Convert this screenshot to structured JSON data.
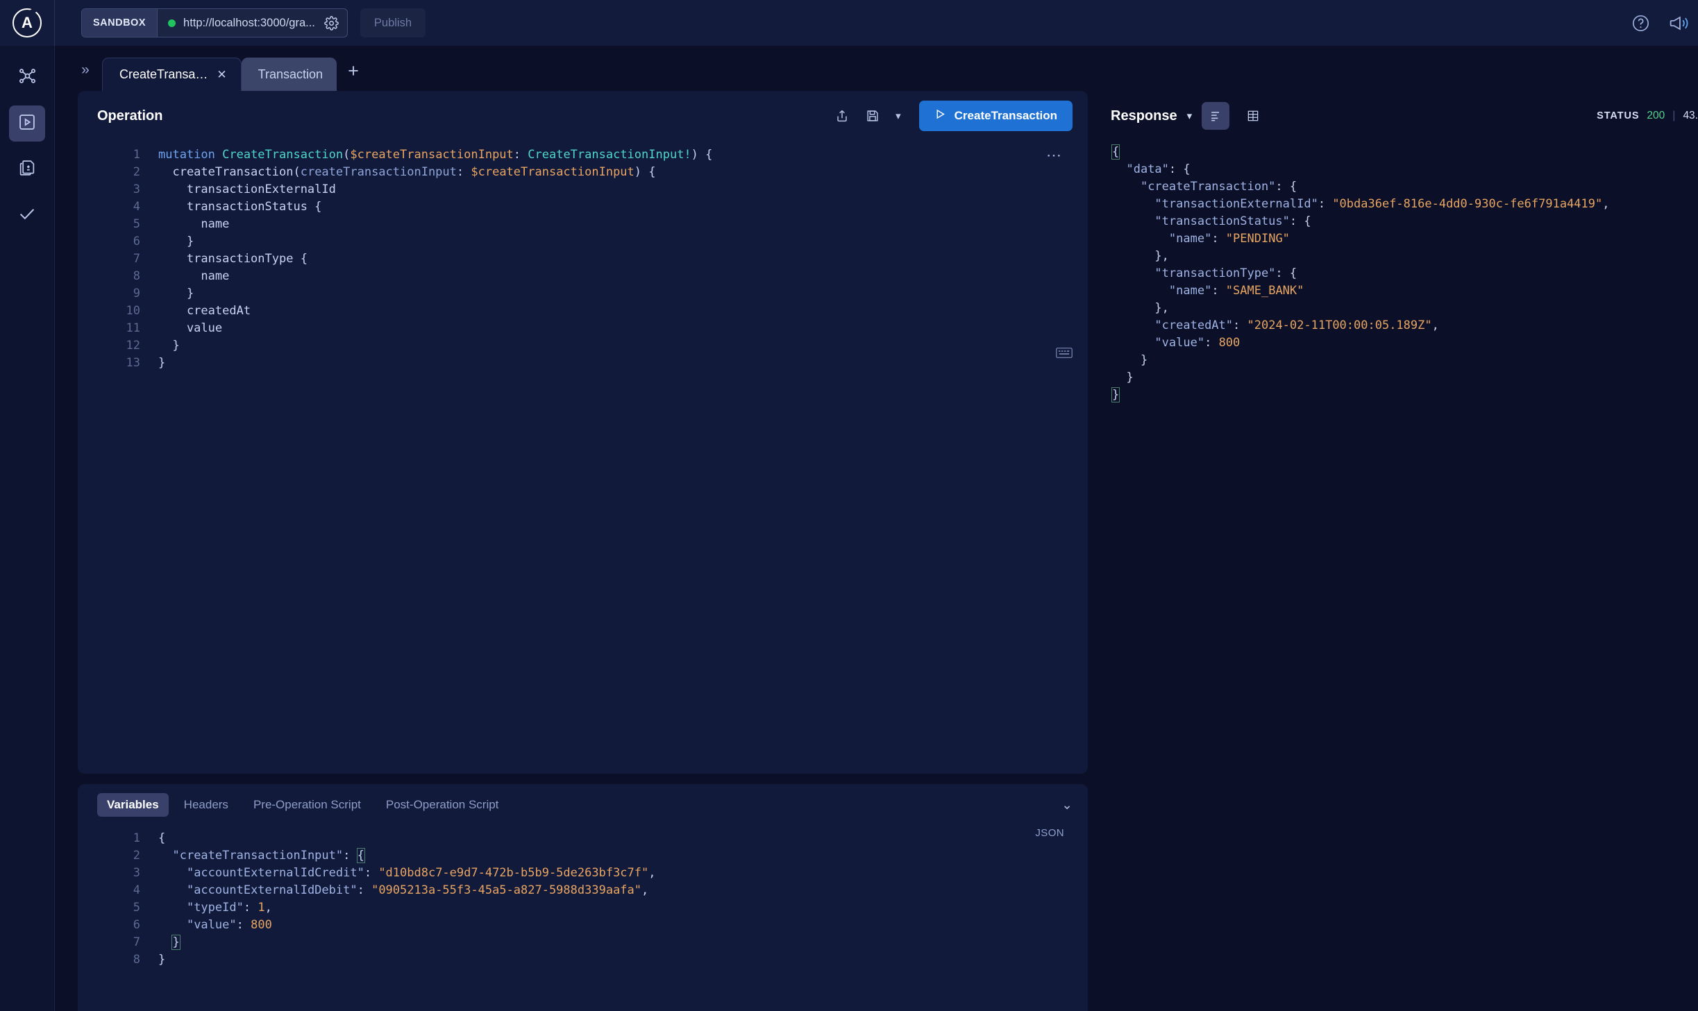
{
  "topbar": {
    "logo_letter": "A",
    "sandbox_chip": "SANDBOX",
    "url": "http://localhost:3000/gra...",
    "publish_label": "Publish",
    "gear_icon": "gear-icon",
    "help_icon": "help-circle-icon",
    "announce_icon": "megaphone-icon"
  },
  "rail": {
    "items": [
      {
        "icon": "schema-graph-icon",
        "active": false
      },
      {
        "icon": "explorer-play-icon",
        "active": true
      },
      {
        "icon": "schema-diff-icon",
        "active": false
      },
      {
        "icon": "checks-checkmark-icon",
        "active": false
      }
    ]
  },
  "tabs": {
    "expand_icon": "chevron-double-right-icon",
    "add_icon": "plus-icon",
    "items": [
      {
        "label": "CreateTransa…",
        "active": true,
        "closable": true
      },
      {
        "label": "Transaction",
        "active": false,
        "closable": false
      }
    ]
  },
  "operation": {
    "title": "Operation",
    "share_icon": "share-upload-icon",
    "save_icon": "save-floppy-icon",
    "save_chevron": "chevron-down-icon",
    "run_icon": "play-triangle-icon",
    "run_label": "CreateTransaction",
    "more_menu": "•••",
    "keyboard_icon": "keyboard-shortcuts-icon",
    "lines": [
      {
        "n": "1",
        "tokens": [
          {
            "t": "mutation ",
            "c": "k-kw"
          },
          {
            "t": "CreateTransaction",
            "c": "k-opname"
          },
          {
            "t": "(",
            "c": "k-punct"
          },
          {
            "t": "$createTransactionInput",
            "c": "k-var"
          },
          {
            "t": ": ",
            "c": "k-punct"
          },
          {
            "t": "CreateTransactionInput!",
            "c": "k-opname"
          },
          {
            "t": ") {",
            "c": "k-punct"
          }
        ]
      },
      {
        "n": "2",
        "tokens": [
          {
            "t": "  createTransaction",
            "c": "k-field"
          },
          {
            "t": "(",
            "c": "k-punct"
          },
          {
            "t": "createTransactionInput",
            "c": "k-arg"
          },
          {
            "t": ": ",
            "c": "k-punct"
          },
          {
            "t": "$createTransactionInput",
            "c": "k-var"
          },
          {
            "t": ") {",
            "c": "k-punct"
          }
        ]
      },
      {
        "n": "3",
        "tokens": [
          {
            "t": "    transactionExternalId",
            "c": "k-field"
          }
        ]
      },
      {
        "n": "4",
        "tokens": [
          {
            "t": "    transactionStatus",
            "c": "k-field"
          },
          {
            "t": " {",
            "c": "k-punct"
          }
        ]
      },
      {
        "n": "5",
        "tokens": [
          {
            "t": "      name",
            "c": "k-field"
          }
        ]
      },
      {
        "n": "6",
        "tokens": [
          {
            "t": "    }",
            "c": "k-punct"
          }
        ]
      },
      {
        "n": "7",
        "tokens": [
          {
            "t": "    transactionType",
            "c": "k-field"
          },
          {
            "t": " {",
            "c": "k-punct"
          }
        ]
      },
      {
        "n": "8",
        "tokens": [
          {
            "t": "      name",
            "c": "k-field"
          }
        ]
      },
      {
        "n": "9",
        "tokens": [
          {
            "t": "    }",
            "c": "k-punct"
          }
        ]
      },
      {
        "n": "10",
        "tokens": [
          {
            "t": "    createdAt",
            "c": "k-field"
          }
        ]
      },
      {
        "n": "11",
        "tokens": [
          {
            "t": "    value",
            "c": "k-field"
          }
        ]
      },
      {
        "n": "12",
        "tokens": [
          {
            "t": "  }",
            "c": "k-punct"
          }
        ]
      },
      {
        "n": "13",
        "tokens": [
          {
            "t": "}",
            "c": "k-punct"
          }
        ]
      }
    ]
  },
  "variables_panel": {
    "tabs": [
      {
        "label": "Variables",
        "active": true
      },
      {
        "label": "Headers",
        "active": false
      },
      {
        "label": "Pre-Operation Script",
        "active": false
      },
      {
        "label": "Post-Operation Script",
        "active": false
      }
    ],
    "collapse_icon": "chevron-double-down-icon",
    "format_badge": "JSON",
    "lines": [
      {
        "n": "1",
        "tokens": [
          {
            "t": "{",
            "c": "j-punct"
          }
        ]
      },
      {
        "n": "2",
        "tokens": [
          {
            "t": "  ",
            "c": "j-punct"
          },
          {
            "t": "\"createTransactionInput\"",
            "c": "j-key"
          },
          {
            "t": ": ",
            "c": "j-punct"
          },
          {
            "t": "{",
            "c": "j-brace-hl"
          }
        ]
      },
      {
        "n": "3",
        "tokens": [
          {
            "t": "    ",
            "c": "j-punct"
          },
          {
            "t": "\"accountExternalIdCredit\"",
            "c": "j-key"
          },
          {
            "t": ": ",
            "c": "j-punct"
          },
          {
            "t": "\"d10bd8c7-e9d7-472b-b5b9-5de263bf3c7f\"",
            "c": "j-str"
          },
          {
            "t": ",",
            "c": "j-punct"
          }
        ]
      },
      {
        "n": "4",
        "tokens": [
          {
            "t": "    ",
            "c": "j-punct"
          },
          {
            "t": "\"accountExternalIdDebit\"",
            "c": "j-key"
          },
          {
            "t": ": ",
            "c": "j-punct"
          },
          {
            "t": "\"0905213a-55f3-45a5-a827-5988d339aafa\"",
            "c": "j-str"
          },
          {
            "t": ",",
            "c": "j-punct"
          }
        ]
      },
      {
        "n": "5",
        "tokens": [
          {
            "t": "    ",
            "c": "j-punct"
          },
          {
            "t": "\"typeId\"",
            "c": "j-key"
          },
          {
            "t": ": ",
            "c": "j-punct"
          },
          {
            "t": "1",
            "c": "j-num"
          },
          {
            "t": ",",
            "c": "j-punct"
          }
        ]
      },
      {
        "n": "6",
        "tokens": [
          {
            "t": "    ",
            "c": "j-punct"
          },
          {
            "t": "\"value\"",
            "c": "j-key"
          },
          {
            "t": ": ",
            "c": "j-punct"
          },
          {
            "t": "800",
            "c": "j-num"
          }
        ]
      },
      {
        "n": "7",
        "tokens": [
          {
            "t": "  ",
            "c": "j-punct"
          },
          {
            "t": "}",
            "c": "j-brace-hl"
          }
        ]
      },
      {
        "n": "8",
        "tokens": [
          {
            "t": "}",
            "c": "j-punct"
          }
        ]
      }
    ]
  },
  "response": {
    "title": "Response",
    "chevron_icon": "chevron-down-icon",
    "json_view_icon": "json-lines-icon",
    "table_view_icon": "table-grid-icon",
    "status_label": "STATUS",
    "status_code": "200",
    "divider": "|",
    "response_time": "43.",
    "lines": [
      {
        "tokens": [
          {
            "t": "{",
            "c": "j-brace-hl"
          }
        ]
      },
      {
        "tokens": [
          {
            "t": "  ",
            "c": "j-punct"
          },
          {
            "t": "\"data\"",
            "c": "j-key"
          },
          {
            "t": ": {",
            "c": "j-punct"
          }
        ]
      },
      {
        "tokens": [
          {
            "t": "    ",
            "c": "j-punct"
          },
          {
            "t": "\"createTransaction\"",
            "c": "j-key"
          },
          {
            "t": ": {",
            "c": "j-punct"
          }
        ]
      },
      {
        "tokens": [
          {
            "t": "      ",
            "c": "j-punct"
          },
          {
            "t": "\"transactionExternalId\"",
            "c": "j-key"
          },
          {
            "t": ": ",
            "c": "j-punct"
          },
          {
            "t": "\"0bda36ef-816e-4dd0-930c-fe6f791a4419\"",
            "c": "j-str"
          },
          {
            "t": ",",
            "c": "j-punct"
          }
        ]
      },
      {
        "tokens": [
          {
            "t": "      ",
            "c": "j-punct"
          },
          {
            "t": "\"transactionStatus\"",
            "c": "j-key"
          },
          {
            "t": ": {",
            "c": "j-punct"
          }
        ]
      },
      {
        "tokens": [
          {
            "t": "        ",
            "c": "j-punct"
          },
          {
            "t": "\"name\"",
            "c": "j-key"
          },
          {
            "t": ": ",
            "c": "j-punct"
          },
          {
            "t": "\"PENDING\"",
            "c": "j-str"
          }
        ]
      },
      {
        "tokens": [
          {
            "t": "      },",
            "c": "j-punct"
          }
        ]
      },
      {
        "tokens": [
          {
            "t": "      ",
            "c": "j-punct"
          },
          {
            "t": "\"transactionType\"",
            "c": "j-key"
          },
          {
            "t": ": {",
            "c": "j-punct"
          }
        ]
      },
      {
        "tokens": [
          {
            "t": "        ",
            "c": "j-punct"
          },
          {
            "t": "\"name\"",
            "c": "j-key"
          },
          {
            "t": ": ",
            "c": "j-punct"
          },
          {
            "t": "\"SAME_BANK\"",
            "c": "j-str"
          }
        ]
      },
      {
        "tokens": [
          {
            "t": "      },",
            "c": "j-punct"
          }
        ]
      },
      {
        "tokens": [
          {
            "t": "      ",
            "c": "j-punct"
          },
          {
            "t": "\"createdAt\"",
            "c": "j-key"
          },
          {
            "t": ": ",
            "c": "j-punct"
          },
          {
            "t": "\"2024-02-11T00:00:05.189Z\"",
            "c": "j-str"
          },
          {
            "t": ",",
            "c": "j-punct"
          }
        ]
      },
      {
        "tokens": [
          {
            "t": "      ",
            "c": "j-punct"
          },
          {
            "t": "\"value\"",
            "c": "j-key"
          },
          {
            "t": ": ",
            "c": "j-punct"
          },
          {
            "t": "800",
            "c": "j-num"
          }
        ]
      },
      {
        "tokens": [
          {
            "t": "    }",
            "c": "j-punct"
          }
        ]
      },
      {
        "tokens": [
          {
            "t": "  }",
            "c": "j-punct"
          }
        ]
      },
      {
        "tokens": [
          {
            "t": "}",
            "c": "j-brace-hl"
          }
        ]
      }
    ]
  },
  "colors": {
    "accent_blue": "#1f72d4",
    "panel_bg": "#121a3b",
    "app_bg": "#0b1028",
    "topbar_bg": "#131b3c",
    "status_green": "#55d38a",
    "dot_green": "#20c35e",
    "string_orange": "#e8a561",
    "type_teal": "#4fd6c6"
  }
}
